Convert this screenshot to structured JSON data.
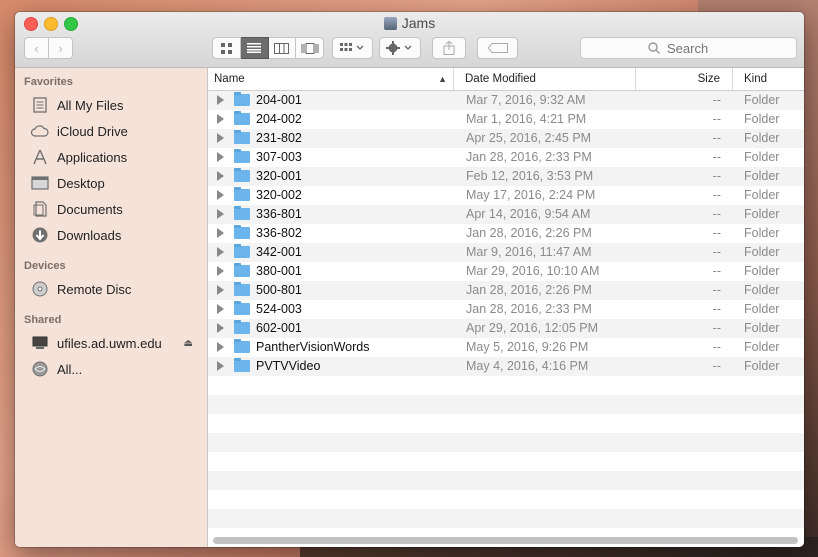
{
  "window": {
    "title": "Jams"
  },
  "toolbar": {
    "back_label": "‹",
    "forward_label": "›",
    "search_placeholder": "Search"
  },
  "sidebar": {
    "favorites_heading": "Favorites",
    "favorites": [
      {
        "label": "All My Files",
        "icon": "all-files-icon"
      },
      {
        "label": "iCloud Drive",
        "icon": "cloud-icon"
      },
      {
        "label": "Applications",
        "icon": "applications-icon"
      },
      {
        "label": "Desktop",
        "icon": "desktop-icon"
      },
      {
        "label": "Documents",
        "icon": "documents-icon"
      },
      {
        "label": "Downloads",
        "icon": "downloads-icon"
      }
    ],
    "devices_heading": "Devices",
    "devices": [
      {
        "label": "Remote Disc",
        "icon": "disc-icon"
      }
    ],
    "shared_heading": "Shared",
    "shared": [
      {
        "label": "ufiles.ad.uwm.edu",
        "icon": "server-icon"
      },
      {
        "label": "All...",
        "icon": "network-icon"
      }
    ]
  },
  "columns": {
    "name": "Name",
    "date": "Date Modified",
    "size": "Size",
    "kind": "Kind"
  },
  "files": [
    {
      "name": "204-001",
      "date": "Mar 7, 2016, 9:32 AM",
      "size": "--",
      "kind": "Folder"
    },
    {
      "name": "204-002",
      "date": "Mar 1, 2016, 4:21 PM",
      "size": "--",
      "kind": "Folder"
    },
    {
      "name": "231-802",
      "date": "Apr 25, 2016, 2:45 PM",
      "size": "--",
      "kind": "Folder"
    },
    {
      "name": "307-003",
      "date": "Jan 28, 2016, 2:33 PM",
      "size": "--",
      "kind": "Folder"
    },
    {
      "name": "320-001",
      "date": "Feb 12, 2016, 3:53 PM",
      "size": "--",
      "kind": "Folder"
    },
    {
      "name": "320-002",
      "date": "May 17, 2016, 2:24 PM",
      "size": "--",
      "kind": "Folder"
    },
    {
      "name": "336-801",
      "date": "Apr 14, 2016, 9:54 AM",
      "size": "--",
      "kind": "Folder"
    },
    {
      "name": "336-802",
      "date": "Jan 28, 2016, 2:26 PM",
      "size": "--",
      "kind": "Folder"
    },
    {
      "name": "342-001",
      "date": "Mar 9, 2016, 11:47 AM",
      "size": "--",
      "kind": "Folder"
    },
    {
      "name": "380-001",
      "date": "Mar 29, 2016, 10:10 AM",
      "size": "--",
      "kind": "Folder"
    },
    {
      "name": "500-801",
      "date": "Jan 28, 2016, 2:26 PM",
      "size": "--",
      "kind": "Folder"
    },
    {
      "name": "524-003",
      "date": "Jan 28, 2016, 2:33 PM",
      "size": "--",
      "kind": "Folder"
    },
    {
      "name": "602-001",
      "date": "Apr 29, 2016, 12:05 PM",
      "size": "--",
      "kind": "Folder"
    },
    {
      "name": "PantherVisionWords",
      "date": "May 5, 2016, 9:26 PM",
      "size": "--",
      "kind": "Folder"
    },
    {
      "name": "PVTVVideo",
      "date": "May 4, 2016, 4:16 PM",
      "size": "--",
      "kind": "Folder"
    }
  ],
  "empty_rows": 9
}
